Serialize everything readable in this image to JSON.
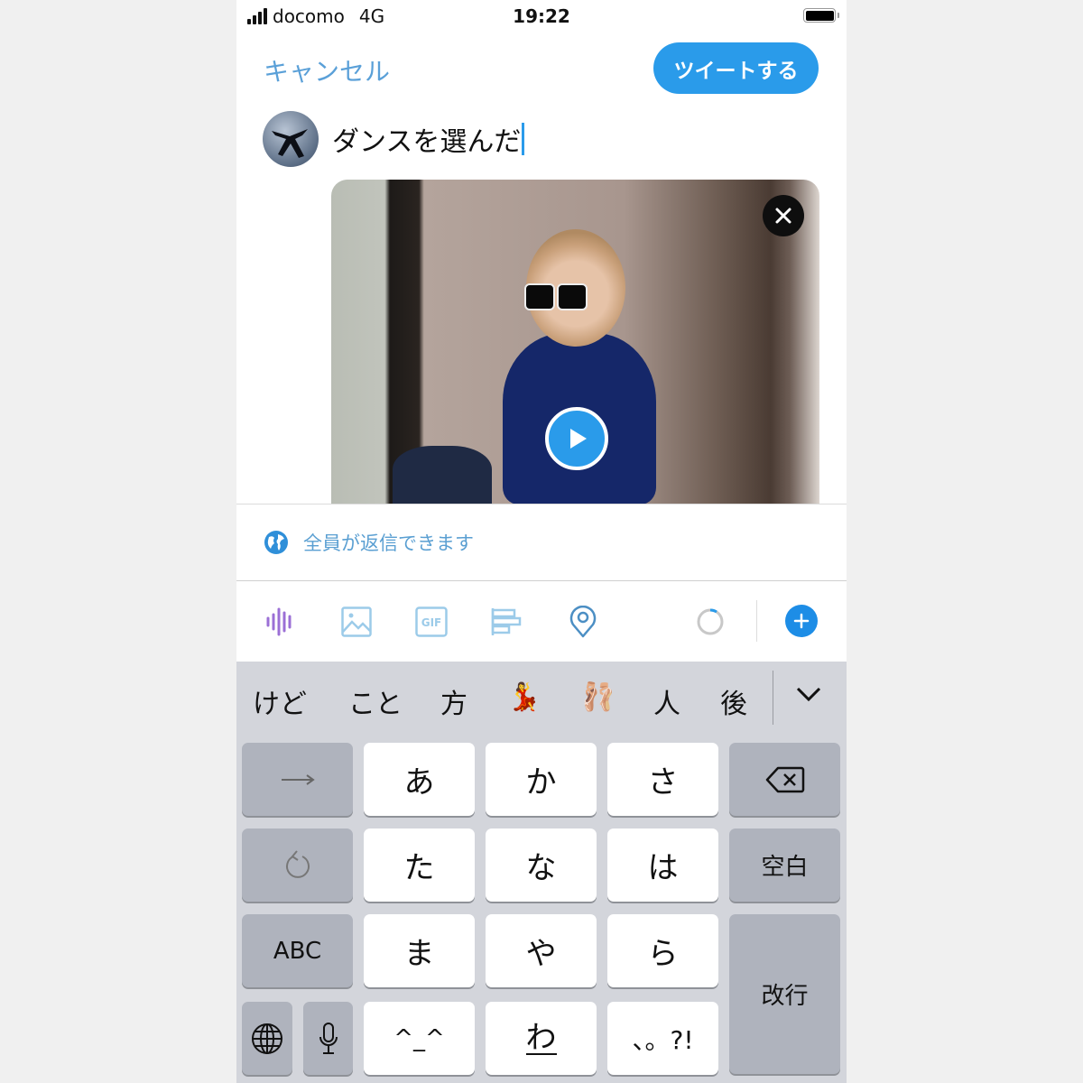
{
  "status_bar": {
    "carrier": "docomo",
    "network": "4G",
    "time": "19:22",
    "signal_bars": 4
  },
  "header": {
    "cancel_label": "キャンセル",
    "tweet_label": "ツイートする"
  },
  "compose": {
    "text": "ダンスを選んだ"
  },
  "media": {
    "type": "gif",
    "remove_icon": "close-icon",
    "play_icon": "play-icon"
  },
  "reply_setting": {
    "icon": "globe-icon",
    "label": "全員が返信できます"
  },
  "toolbar": {
    "items": [
      "voice-icon",
      "image-icon",
      "gif-icon",
      "poll-icon",
      "location-icon"
    ],
    "gif_label": "GIF",
    "progress_icon": "character-count-ring",
    "add_icon": "plus-icon"
  },
  "colors": {
    "accent": "#2a9bea",
    "link": "#5aa0d8",
    "voice": "#9b6fd6",
    "keyboard_bg": "#d3d5db",
    "dark_key": "#afb3bd"
  },
  "keyboard": {
    "suggestions": [
      "けど",
      "こと",
      "方",
      "💃",
      "🩰",
      "人",
      "後"
    ],
    "rows": [
      [
        "→",
        "あ",
        "か",
        "さ",
        "⌫"
      ],
      [
        "↺",
        "た",
        "な",
        "は",
        "空白"
      ],
      [
        "ABC",
        "ま",
        "や",
        "ら",
        "改行"
      ],
      [
        "🌐",
        "🎤",
        "^_^",
        "わ_",
        "、。?!"
      ]
    ],
    "keys": {
      "next": "→",
      "a": "あ",
      "ka": "か",
      "sa": "さ",
      "undo": "↺",
      "ta": "た",
      "na": "な",
      "ha": "は",
      "space": "空白",
      "abc": "ABC",
      "ma": "ま",
      "ya": "や",
      "ra": "ら",
      "return": "改行",
      "kaomoji": "^_^",
      "wa": "わ",
      "punct": "、。?!"
    }
  }
}
